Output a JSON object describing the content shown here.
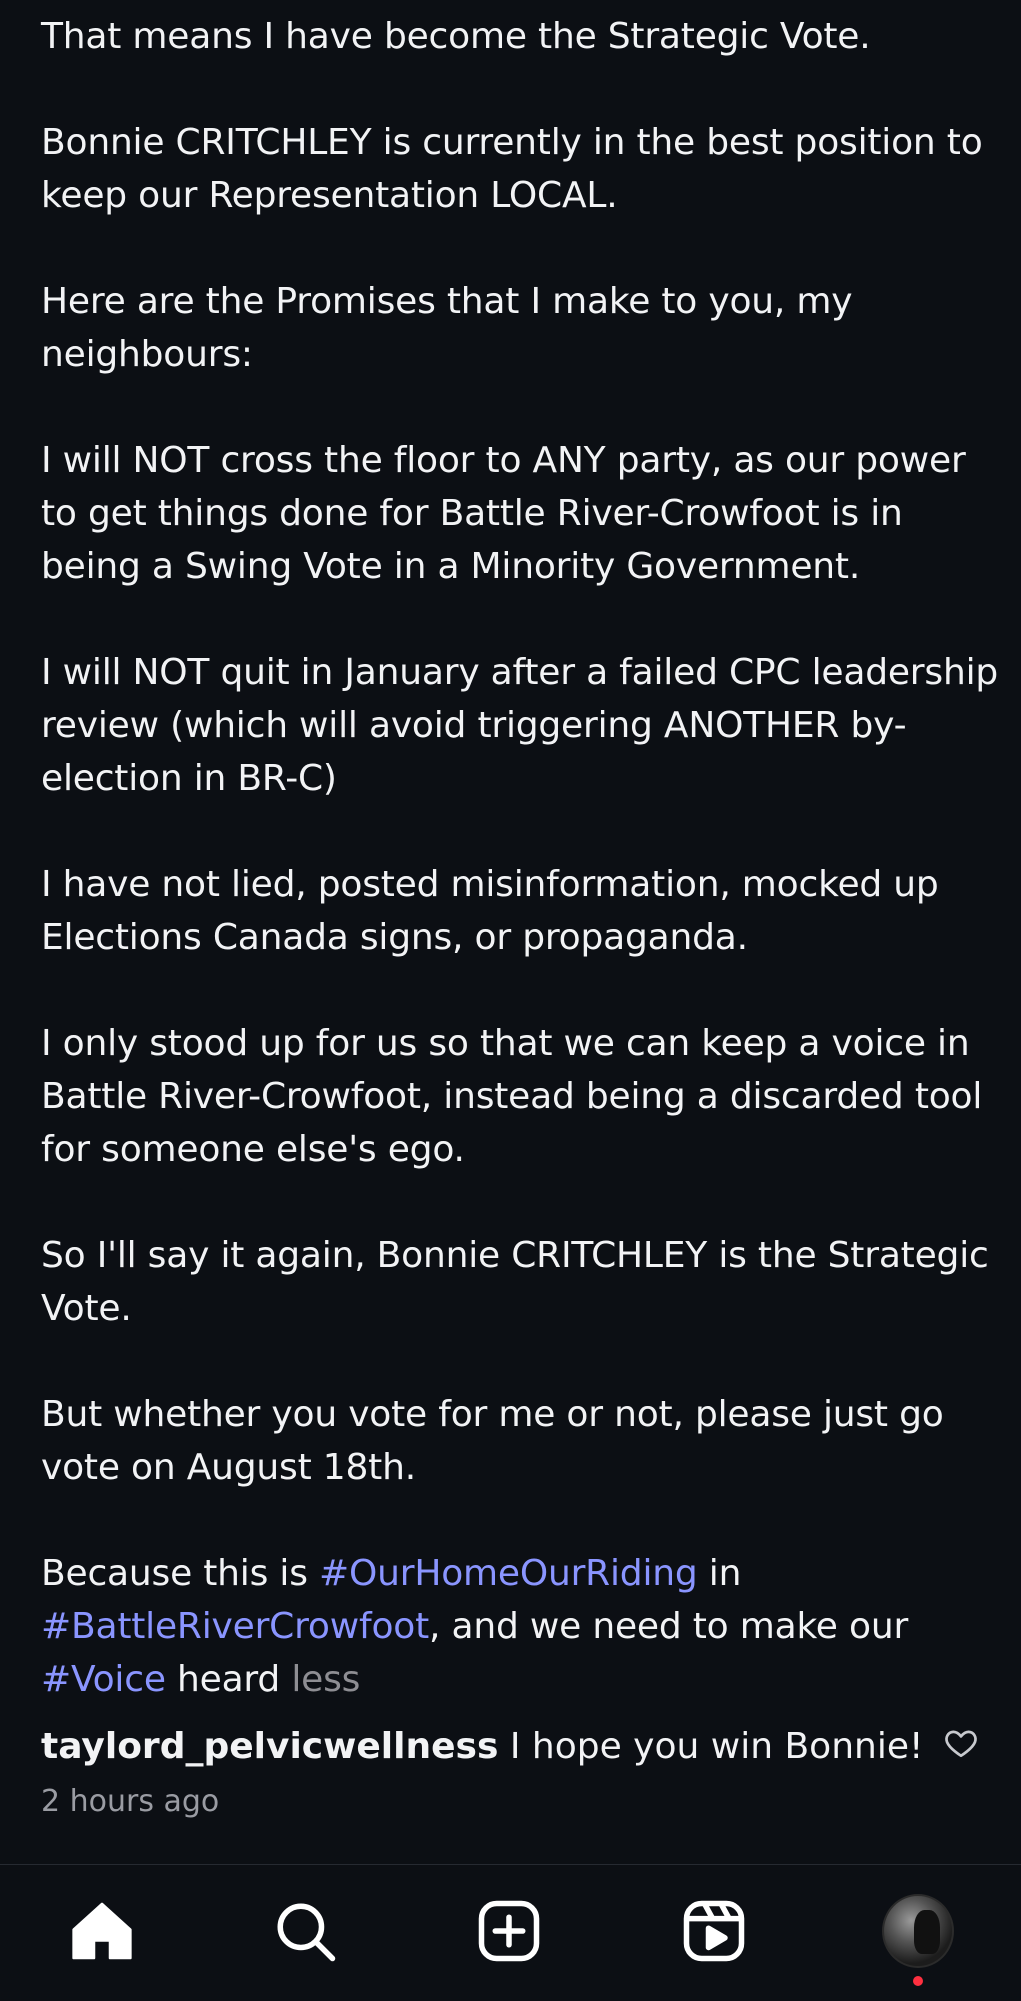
{
  "caption": {
    "paragraphs": [
      "That means I have become the Strategic Vote.",
      "Bonnie CRITCHLEY is currently in the best position to keep our Representation LOCAL.",
      "Here are the Promises that I make to you, my neighbours:",
      "I will NOT cross the floor to ANY party, as our power to get things done for Battle River-Crowfoot is in being a Swing Vote in a Minority Government.",
      "I will NOT quit in January after a failed CPC leadership review (which will avoid triggering ANOTHER by-election in BR-C)",
      "I have not lied, posted misinformation, mocked up Elections Canada signs, or propaganda.",
      "I only stood up for us so that we can keep a voice in Battle River-Crowfoot, instead being a discarded tool for someone else's ego.",
      "So I'll say it again, Bonnie CRITCHLEY is the Strategic Vote.",
      "But whether you vote for me or not, please just go vote on August 18th."
    ],
    "final": {
      "text_1": "Because this is ",
      "hashtag_1": "#OurHomeOurRiding",
      "text_2": " in ",
      "hashtag_2": "#BattleRiverCrowfoot",
      "text_3": ", and we need to make our ",
      "hashtag_3": "#Voice",
      "text_4": " heard ",
      "more_label": "less"
    }
  },
  "comment": {
    "username": "taylord_pelvicwellness",
    "text": " I hope you win Bonnie!",
    "timestamp": "2 hours ago",
    "like_icon": "heart-outline-icon"
  },
  "bottom_nav": {
    "items": [
      "home-icon",
      "search-icon",
      "create-post-icon",
      "reels-icon",
      "profile-avatar"
    ],
    "notification_dot_color": "#ff3040"
  },
  "colors": {
    "background": "#0c0f14",
    "text": "#f2f3f5",
    "hashtag": "#8a95ff",
    "muted": "#9a9ca3"
  }
}
